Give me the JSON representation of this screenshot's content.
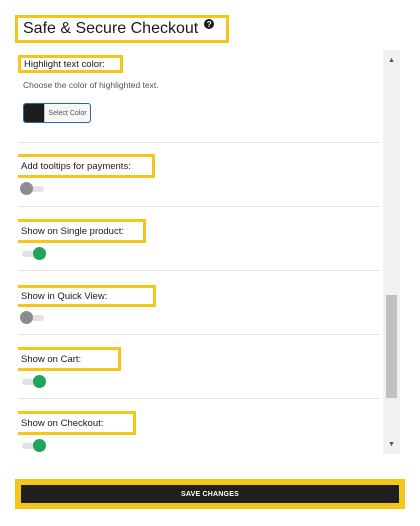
{
  "header": {
    "title": "Safe & Secure Checkout",
    "help_icon": "question-circle-icon",
    "help_glyph": "?"
  },
  "settings": {
    "highlight_text_color": {
      "label": "Highlight text color:",
      "description": "Choose the color of highlighted text.",
      "button_label": "Select Color",
      "color": "#1d1d1d"
    },
    "tooltips_for_payments": {
      "label": "Add tooltips for payments:",
      "enabled": false
    },
    "show_on_single_product": {
      "label": "Show on Single product:",
      "enabled": true
    },
    "show_in_quick_view": {
      "label": "Show in Quick View:",
      "enabled": false
    },
    "show_on_cart": {
      "label": "Show on Cart:",
      "enabled": true
    },
    "show_on_checkout": {
      "label": "Show on Checkout:",
      "enabled": true
    }
  },
  "footer": {
    "save_label": "SAVE CHANGES"
  },
  "colors": {
    "highlight_outline": "#f5c518",
    "toggle_on": "#21a35a",
    "toggle_off": "#8c8c8c",
    "button_bg": "#1f1f1f"
  }
}
